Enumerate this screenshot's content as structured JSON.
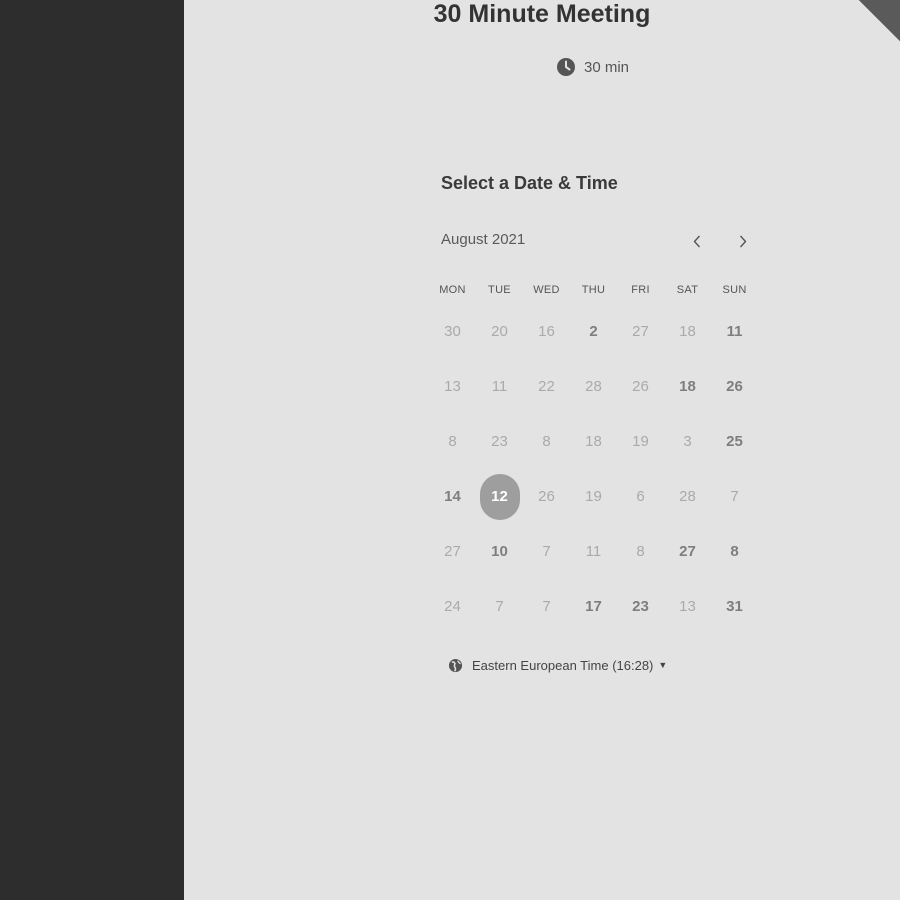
{
  "event": {
    "title": "30 Minute Meeting",
    "duration": "30 min"
  },
  "picker": {
    "heading": "Select a Date & Time",
    "month": "August 2021",
    "prev_icon": "chevron-left-icon",
    "next_icon": "chevron-right-icon",
    "weekdays": [
      "MON",
      "TUE",
      "WED",
      "THU",
      "FRI",
      "SAT",
      "SUN"
    ],
    "weeks": [
      [
        {
          "d": "30",
          "s": "off"
        },
        {
          "d": "20",
          "s": "off"
        },
        {
          "d": "16",
          "s": "off"
        },
        {
          "d": "2",
          "s": "avail"
        },
        {
          "d": "27",
          "s": "off"
        },
        {
          "d": "18",
          "s": "off"
        },
        {
          "d": "11",
          "s": "avail"
        }
      ],
      [
        {
          "d": "13",
          "s": "off"
        },
        {
          "d": "11",
          "s": "off"
        },
        {
          "d": "22",
          "s": "off"
        },
        {
          "d": "28",
          "s": "off"
        },
        {
          "d": "26",
          "s": "off"
        },
        {
          "d": "18",
          "s": "avail"
        },
        {
          "d": "26",
          "s": "avail"
        }
      ],
      [
        {
          "d": "8",
          "s": "off"
        },
        {
          "d": "23",
          "s": "off"
        },
        {
          "d": "8",
          "s": "off"
        },
        {
          "d": "18",
          "s": "off"
        },
        {
          "d": "19",
          "s": "off"
        },
        {
          "d": "3",
          "s": "off"
        },
        {
          "d": "25",
          "s": "avail"
        }
      ],
      [
        {
          "d": "14",
          "s": "avail"
        },
        {
          "d": "12",
          "s": "selected"
        },
        {
          "d": "26",
          "s": "off"
        },
        {
          "d": "19",
          "s": "off"
        },
        {
          "d": "6",
          "s": "off"
        },
        {
          "d": "28",
          "s": "off"
        },
        {
          "d": "7",
          "s": "off"
        }
      ],
      [
        {
          "d": "27",
          "s": "off"
        },
        {
          "d": "10",
          "s": "avail"
        },
        {
          "d": "7",
          "s": "off"
        },
        {
          "d": "11",
          "s": "off"
        },
        {
          "d": "8",
          "s": "off"
        },
        {
          "d": "27",
          "s": "avail"
        },
        {
          "d": "8",
          "s": "avail"
        }
      ],
      [
        {
          "d": "24",
          "s": "off"
        },
        {
          "d": "7",
          "s": "off"
        },
        {
          "d": "7",
          "s": "off"
        },
        {
          "d": "17",
          "s": "avail"
        },
        {
          "d": "23",
          "s": "avail"
        },
        {
          "d": "13",
          "s": "off"
        },
        {
          "d": "31",
          "s": "avail"
        }
      ]
    ]
  },
  "timezone": {
    "label": "Eastern European Time (16:28)",
    "icon": "globe-icon"
  },
  "colors": {
    "sidebar": "#2d2d2d",
    "page": "#e3e3e3",
    "selected": "#9e9e9e"
  }
}
